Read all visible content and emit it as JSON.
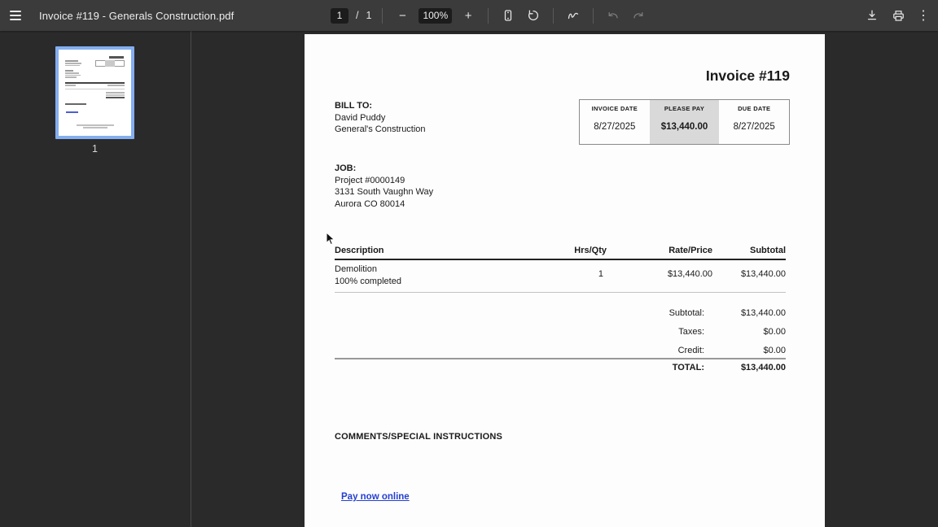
{
  "colors": {
    "toolbar_bg": "#3b3b3b",
    "viewer_bg": "#2a2a2a",
    "box_bg": "#1c1c1c",
    "toolbar_text": "#e8e8e8",
    "separator": "#5a5a5a",
    "icon_dim": "#7a7a7a",
    "thumb_border": "#84aef0",
    "page_bg": "#fdfdfd",
    "ink": "#1a1a1a",
    "please_pay_bg": "#d9d9d9",
    "link_blue": "#2540d0",
    "table_border": "#8a8a8a"
  },
  "toolbar": {
    "title": "Invoice #119 - Generals Construction.pdf",
    "page_current": "1",
    "page_divider": "/",
    "page_count": "1",
    "zoom_out": "−",
    "zoom_level": "100%",
    "zoom_in": "+",
    "kebab_glyph": "⋮"
  },
  "icons": {
    "menu": "hamburger-menu",
    "fit": "fit-to-page",
    "rotate": "rotate-counterclockwise",
    "annotate": "ink-annotate",
    "undo": "undo",
    "redo": "redo",
    "download": "download",
    "print": "print",
    "more": "kebab-menu"
  },
  "sidebar": {
    "thumbnail_label": "1"
  },
  "invoice": {
    "title": "Invoice #119",
    "header_table": {
      "columns": [
        {
          "label": "INVOICE DATE",
          "value": "8/27/2025"
        },
        {
          "label": "PLEASE PAY",
          "value": "$13,440.00"
        },
        {
          "label": "DUE DATE",
          "value": "8/27/2025"
        }
      ]
    },
    "bill_to": {
      "heading": "BILL TO:",
      "lines": [
        "David Puddy",
        "General's Construction"
      ]
    },
    "job": {
      "heading": "JOB:",
      "lines": [
        "Project #0000149",
        "3131 South Vaughn Way",
        "Aurora CO 80014"
      ]
    },
    "items_table": {
      "headers": [
        "Description",
        "Hrs/Qty",
        "Rate/Price",
        "Subtotal"
      ],
      "rows": [
        {
          "description_line1": "Demolition",
          "description_line2": "100% completed",
          "qty": "1",
          "rate": "$13,440.00",
          "subtotal": "$13,440.00"
        }
      ]
    },
    "totals": [
      {
        "label": "Subtotal:",
        "value": "$13,440.00"
      },
      {
        "label": "Taxes:",
        "value": "$0.00"
      },
      {
        "label": "Credit:",
        "value": "$0.00"
      },
      {
        "label": "TOTAL:",
        "value": "$13,440.00"
      }
    ],
    "comments_heading": "COMMENTS/SPECIAL INSTRUCTIONS",
    "pay_link": "Pay now online"
  }
}
